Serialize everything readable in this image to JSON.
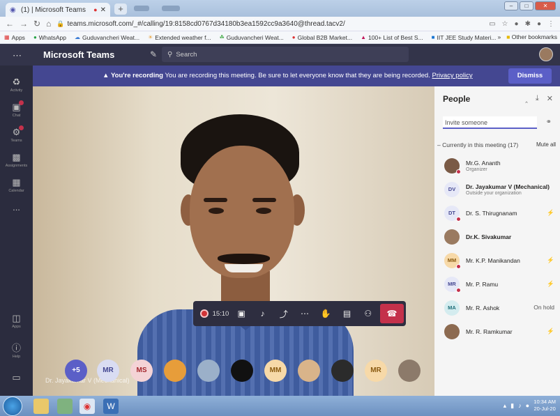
{
  "browser": {
    "tab_title": "(1) | Microsoft Teams",
    "new_tab": "+",
    "url": "teams.microsoft.com/_#/calling/19:8158cd0767d34180b3ea1592cc9a3640@thread.tacv2/",
    "bookmarks": [
      "Apps",
      "WhatsApp",
      "Guduvancheri Weat...",
      "Extended weather f...",
      "Guduvancheri Weat...",
      "Global B2B Market...",
      "100+ List of Best S...",
      "IIT JEE Study Materi..."
    ],
    "other_bookmarks": "Other bookmarks",
    "more": "»"
  },
  "teams": {
    "title": "Microsoft Teams",
    "search_placeholder": "Search",
    "rail": [
      {
        "label": "Activity",
        "icon": "bell-icon"
      },
      {
        "label": "Chat",
        "icon": "chat-icon"
      },
      {
        "label": "Teams",
        "icon": "teams-icon"
      },
      {
        "label": "Assignments",
        "icon": "assignments-icon"
      },
      {
        "label": "Calendar",
        "icon": "calendar-icon"
      },
      {
        "label": "...",
        "icon": "more-icon"
      },
      {
        "label": "Apps",
        "icon": "apps-icon"
      },
      {
        "label": "Help",
        "icon": "help-icon"
      }
    ],
    "banner": {
      "bold": "You're recording",
      "text": "You are recording this meeting. Be sure to let everyone know that they are being recorded.",
      "link": "Privacy policy",
      "dismiss": "Dismiss"
    },
    "video": {
      "name_overlay": "Dr. Jayakumar V (Mechanical)"
    },
    "controls": {
      "timer": "15:10"
    },
    "strip": [
      {
        "label": "+5",
        "color": "#5b5fc7",
        "text_color": "#ffffff"
      },
      {
        "label": "MR",
        "color": "#d9dcf2",
        "text_color": "#444791"
      },
      {
        "label": "MS",
        "color": "#f4d3d6",
        "text_color": "#a4262c"
      },
      {
        "label": "",
        "color": "#e79d3a",
        "text_color": "#ffffff"
      },
      {
        "label": "",
        "color": "#9bb0c9",
        "text_color": "#ffffff"
      },
      {
        "label": "",
        "color": "#111111",
        "text_color": "#ffffff"
      },
      {
        "label": "MM",
        "color": "#f7d9a8",
        "text_color": "#8a5a10"
      },
      {
        "label": "",
        "color": "#d9b48a",
        "text_color": "#ffffff"
      },
      {
        "label": "",
        "color": "#2b2b2b",
        "text_color": "#ffffff"
      },
      {
        "label": "MR",
        "color": "#f7d9a8",
        "text_color": "#8a5a10"
      },
      {
        "label": "",
        "color": "#8c7a6a",
        "text_color": "#ffffff"
      }
    ],
    "people": {
      "title": "People",
      "invite_placeholder": "Invite someone",
      "section": "Currently in this meeting (17)",
      "mute_all": "Mute all",
      "list": [
        {
          "initials": "",
          "name": "Mr.G. Ananth",
          "sub": "Organizer",
          "right": "",
          "bold": false,
          "color": "#7a5a45",
          "text_color": "#ffffff",
          "dot": true
        },
        {
          "initials": "DV",
          "name": "Dr. Jayakumar V (Mechanical)",
          "sub": "Outside your organization",
          "right": "",
          "bold": true,
          "color": "#e6e8f7",
          "text_color": "#444791",
          "dot": false
        },
        {
          "initials": "DT",
          "name": "Dr. S. Thirugnanam",
          "sub": "",
          "right": "mic-off",
          "bold": false,
          "color": "#e6e8f7",
          "text_color": "#444791",
          "dot": true
        },
        {
          "initials": "",
          "name": "Dr.K. Sivakumar",
          "sub": "",
          "right": "",
          "bold": true,
          "color": "#9a7a60",
          "text_color": "#ffffff",
          "dot": false
        },
        {
          "initials": "MM",
          "name": "Mr. K.P. Manikandan",
          "sub": "",
          "right": "mic-off",
          "bold": false,
          "color": "#f7d9a8",
          "text_color": "#8a5a10",
          "dot": true
        },
        {
          "initials": "MR",
          "name": "Mr. P. Ramu",
          "sub": "",
          "right": "mic-off",
          "bold": false,
          "color": "#e6e8f7",
          "text_color": "#444791",
          "dot": true
        },
        {
          "initials": "MA",
          "name": "Mr. R. Ashok",
          "sub": "",
          "right": "On hold",
          "bold": false,
          "color": "#d4ecef",
          "text_color": "#1f6f7a",
          "dot": false
        },
        {
          "initials": "",
          "name": "Mr. R. Ramkumar",
          "sub": "",
          "right": "mic-off",
          "bold": false,
          "color": "#8c6a50",
          "text_color": "#ffffff",
          "dot": false
        }
      ]
    }
  },
  "taskbar": {
    "time": "10:34 AM",
    "date": "20-Jul-20"
  },
  "colors": {
    "teams_header": "#33344a",
    "banner": "#444791",
    "accent": "#5b5fc7",
    "hangup": "#c4314b"
  }
}
